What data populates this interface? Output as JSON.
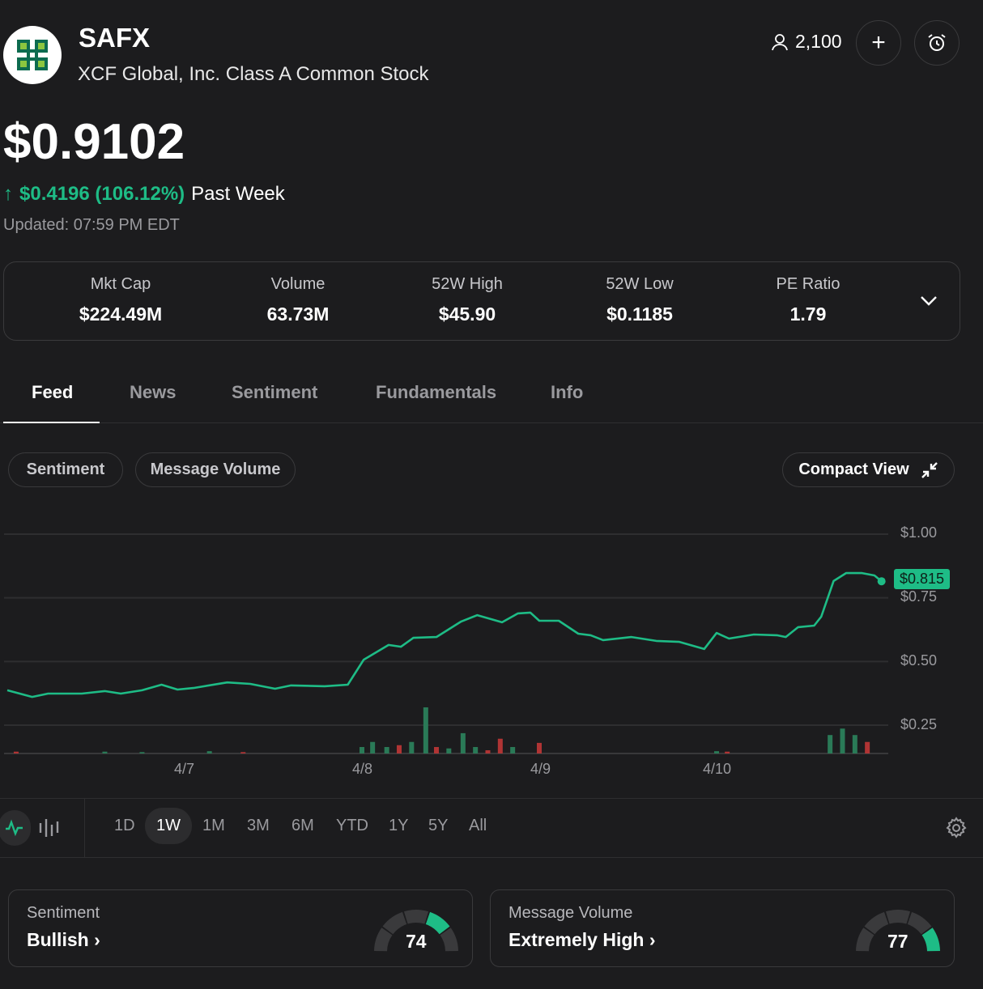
{
  "header": {
    "ticker": "SAFX",
    "company": "XCF Global, Inc. Class A Common Stock",
    "followers": "2,100",
    "add_label": "+"
  },
  "quote": {
    "price": "$0.9102",
    "change_arrow": "↑",
    "change": "$0.4196 (106.12%)",
    "period": "Past Week",
    "updated": "Updated: 07:59 PM EDT"
  },
  "stats": [
    {
      "label": "Mkt Cap",
      "value": "$224.49M"
    },
    {
      "label": "Volume",
      "value": "63.73M"
    },
    {
      "label": "52W High",
      "value": "$45.90"
    },
    {
      "label": "52W Low",
      "value": "$0.1185"
    },
    {
      "label": "PE Ratio",
      "value": "1.79"
    }
  ],
  "tabs": [
    "Feed",
    "News",
    "Sentiment",
    "Fundamentals",
    "Info"
  ],
  "chart_controls": {
    "sentiment": "Sentiment",
    "message_volume": "Message Volume",
    "compact_view": "Compact View"
  },
  "ranges": [
    "1D",
    "1W",
    "1M",
    "3M",
    "6M",
    "YTD",
    "1Y",
    "5Y",
    "All"
  ],
  "active_range": "1W",
  "colors": {
    "up": "#1ebc86",
    "vol_up": "#2a7a57",
    "vol_down": "#b03434",
    "bg": "#1c1c1e"
  },
  "chart_data": {
    "type": "line",
    "y_ticks": [
      "$1.00",
      "$0.75",
      "$0.50",
      "$0.25"
    ],
    "y_tick_values": [
      1.0,
      0.75,
      0.5,
      0.25
    ],
    "x_ticks": [
      "4/7",
      "4/8",
      "4/9",
      "4/10"
    ],
    "x_tick_values": [
      7,
      8,
      9,
      10
    ],
    "ylim": [
      0.167,
      1.0
    ],
    "last_price_label": "$0.815",
    "price": {
      "x": [
        6.0,
        6.14,
        6.23,
        6.42,
        6.55,
        6.64,
        6.76,
        6.87,
        6.96,
        7.05,
        7.24,
        7.37,
        7.51,
        7.6,
        7.79,
        7.92,
        8.01,
        8.15,
        8.22,
        8.29,
        8.42,
        8.56,
        8.65,
        8.79,
        8.88,
        8.95,
        9.0,
        9.11,
        9.22,
        9.29,
        9.36,
        9.52,
        9.66,
        9.79,
        9.93,
        10.0,
        10.07,
        10.21,
        10.34,
        10.39,
        10.46,
        10.55,
        10.59,
        10.66,
        10.73,
        10.82,
        10.89,
        10.93
      ],
      "y": [
        0.387,
        0.361,
        0.374,
        0.374,
        0.384,
        0.374,
        0.387,
        0.409,
        0.39,
        0.396,
        0.418,
        0.412,
        0.393,
        0.406,
        0.403,
        0.409,
        0.507,
        0.565,
        0.558,
        0.593,
        0.596,
        0.657,
        0.682,
        0.654,
        0.689,
        0.692,
        0.66,
        0.66,
        0.609,
        0.603,
        0.584,
        0.596,
        0.581,
        0.577,
        0.549,
        0.612,
        0.59,
        0.606,
        0.603,
        0.596,
        0.635,
        0.641,
        0.676,
        0.816,
        0.847,
        0.847,
        0.838,
        0.815
      ]
    },
    "volume": {
      "x": [
        6.05,
        6.55,
        6.76,
        7.14,
        7.33,
        8.0,
        8.06,
        8.14,
        8.21,
        8.28,
        8.36,
        8.42,
        8.49,
        8.57,
        8.64,
        8.71,
        8.78,
        8.85,
        9.0,
        10.0,
        10.06,
        10.64,
        10.71,
        10.78,
        10.85
      ],
      "y": [
        4,
        4,
        3,
        5,
        3,
        14,
        25,
        14,
        18,
        25,
        100,
        14,
        11,
        44,
        14,
        7,
        32,
        14,
        23,
        5,
        4,
        40,
        54,
        40,
        25
      ],
      "dir": [
        "down",
        "up",
        "up",
        "up",
        "down",
        "up",
        "up",
        "up",
        "down",
        "up",
        "up",
        "down",
        "up",
        "up",
        "up",
        "down",
        "down",
        "up",
        "down",
        "up",
        "down",
        "up",
        "up",
        "up",
        "down"
      ]
    }
  },
  "cards": [
    {
      "label": "Sentiment",
      "value": "Bullish",
      "score": "74",
      "segment": 4
    },
    {
      "label": "Message Volume",
      "value": "Extremely High",
      "score": "77",
      "segment": 5
    }
  ]
}
